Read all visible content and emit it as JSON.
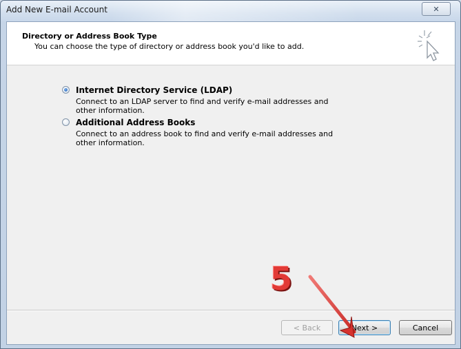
{
  "window": {
    "title": "Add New E-mail Account",
    "close_glyph": "✕"
  },
  "header": {
    "title": "Directory or Address Book Type",
    "subtitle": "You can choose the type of directory or address book you'd like to add.",
    "icon": "wizard-cursor-icon"
  },
  "options": [
    {
      "label": "Internet Directory Service (LDAP)",
      "description": "Connect to an LDAP server to find and verify e-mail addresses and other information.",
      "selected": true
    },
    {
      "label": "Additional Address Books",
      "description": "Connect to an address book to find and verify e-mail addresses and other information.",
      "selected": false
    }
  ],
  "buttons": {
    "back": "< Back",
    "next": "Next >",
    "cancel": "Cancel"
  },
  "annotation": {
    "step_number": "5",
    "color": "#e23a36"
  }
}
